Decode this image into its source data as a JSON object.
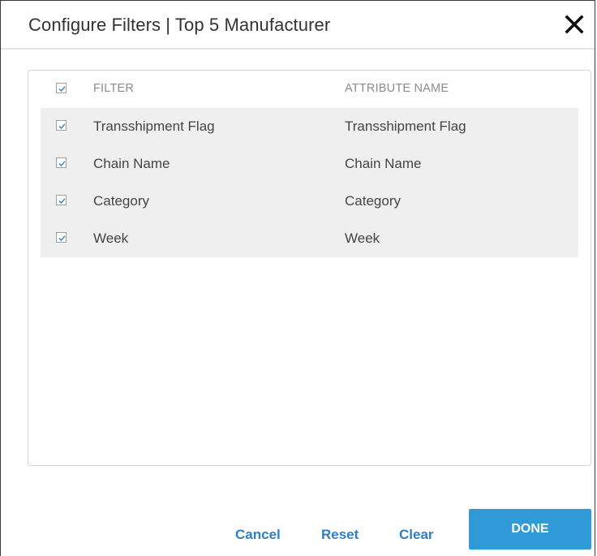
{
  "dialog": {
    "title": "Configure Filters | Top 5 Manufacturer"
  },
  "table": {
    "headers": {
      "filter": "FILTER",
      "attribute": "ATTRIBUTE NAME"
    },
    "header_checked": true,
    "rows": [
      {
        "filter": "Transshipment Flag",
        "attribute": "Transshipment Flag",
        "checked": true
      },
      {
        "filter": "Chain Name",
        "attribute": "Chain Name",
        "checked": true
      },
      {
        "filter": "Category",
        "attribute": "Category",
        "checked": true
      },
      {
        "filter": "Week",
        "attribute": "Week",
        "checked": true
      }
    ]
  },
  "footer": {
    "cancel_label": "Cancel",
    "reset_label": "Reset",
    "clear_label": "Clear",
    "done_label": "DONE"
  },
  "colors": {
    "accent": "#2f9ad6",
    "link": "#2f7fc6",
    "row_bg": "#efefef"
  },
  "icons": {
    "close": "close-icon",
    "checkbox": "checkmark-icon"
  }
}
